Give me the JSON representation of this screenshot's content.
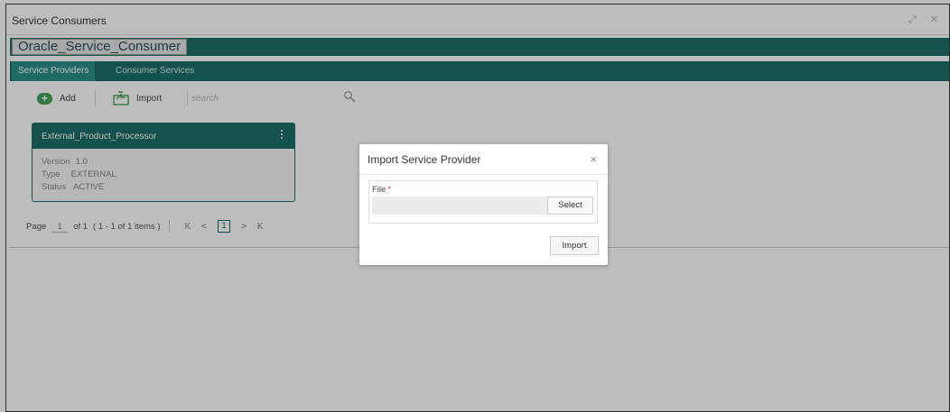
{
  "window": {
    "title": "Service Consumers",
    "controls": "⤢ ✕"
  },
  "consumer": {
    "name": "Oracle_Service_Consumer"
  },
  "tabs": [
    {
      "label": "Service Providers",
      "active": true
    },
    {
      "label": "Consumer Services",
      "active": false
    }
  ],
  "toolbar": {
    "add_label": "Add",
    "import_label": "Import",
    "search_placeholder": "search"
  },
  "provider_card": {
    "title": "External_Product_Processor",
    "version_key": "Version",
    "version_value": "1.0",
    "type_key": "Type",
    "type_value": "EXTERNAL",
    "status_key": "Status",
    "status_value": "ACTIVE"
  },
  "pager": {
    "page_label": "Page",
    "page_value": "1",
    "of_label": "of 1",
    "items_label": "( 1 - 1 of 1 items )",
    "first": "K",
    "prev": "<",
    "current": "1",
    "next": ">",
    "last": "K"
  },
  "modal": {
    "title": "Import Service Provider",
    "close": "×",
    "file_label": "File",
    "required_mark": "*",
    "select_label": "Select",
    "import_label": "Import"
  },
  "colors": {
    "accent": "#1e6f68",
    "tab_active": "#2a8f86",
    "add_icon": "#4aa35a"
  }
}
